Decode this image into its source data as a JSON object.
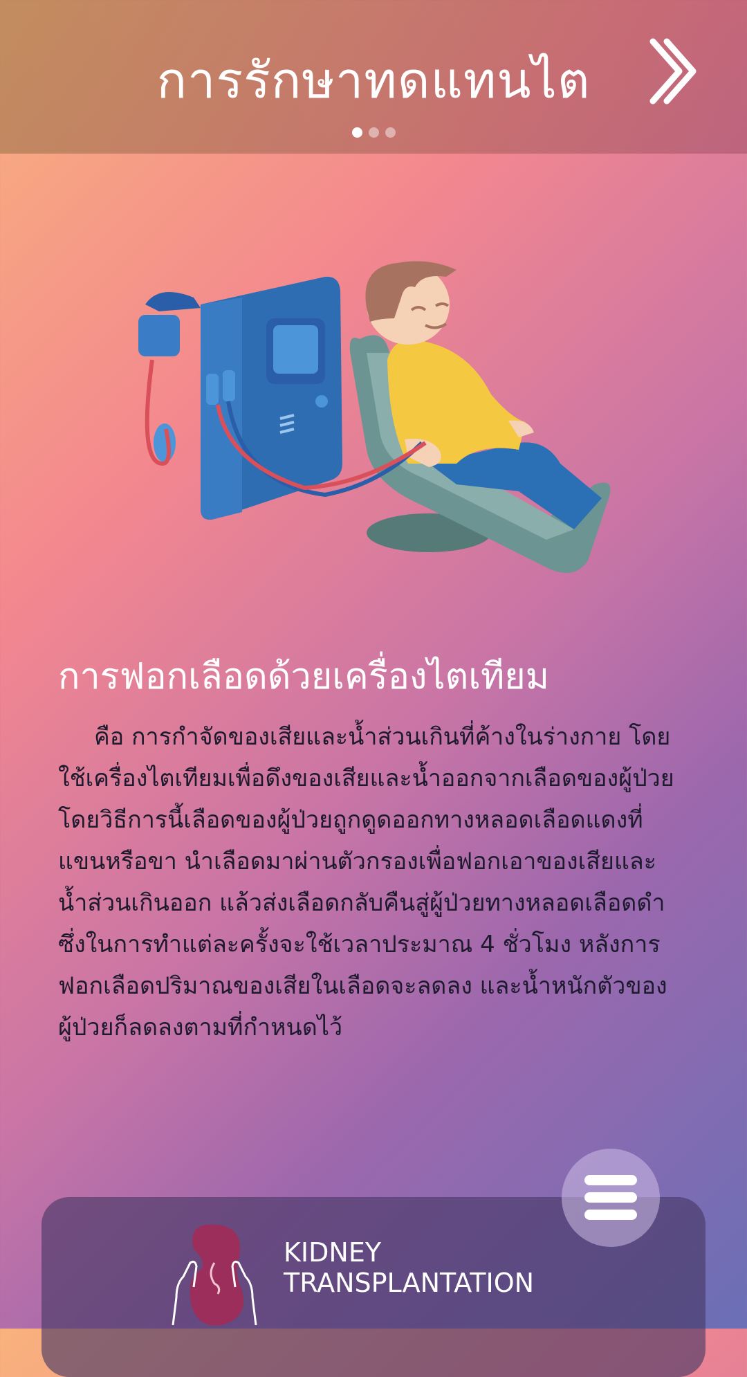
{
  "header": {
    "title": "การรักษาทดแทนไต",
    "page_indicator": {
      "total": 3,
      "active_index": 0
    }
  },
  "icons": {
    "next": "chevron-double-right-icon",
    "menu": "hamburger-menu-icon",
    "logo": "kidney-hands-icon"
  },
  "content": {
    "title": "การฟอกเลือดด้วยเครื่องไตเทียม",
    "paragraph": "คือ การกำจัดของเสียและน้ำส่วนเกินที่ค้างในร่างกาย โดยใช้เครื่องไตเทียมเพื่อดึงของเสียและน้ำออกจากเลือดของผู้ป่วยโดยวิธีการนี้เลือดของผู้ป่วยถูกดูดออกทางหลอดเลือดแดงที่แขนหรือขา นำเลือดมาผ่านตัวกรองเพื่อฟอกเอาของเสียและน้ำส่วนเกินออก แล้วส่งเลือดกลับคืนสู่ผู้ป่วยทางหลอดเลือดดำ ซึ่งในการทำแต่ละครั้งจะใช้เวลาประมาณ 4 ชั่วโมง หลังการฟอกเลือดปริมาณของเสียในเลือดจะลดลง และน้ำหนักตัวของผู้ป่วยก็ลดลงตามที่กำหนดไว้"
  },
  "brand": {
    "line1": "KIDNEY",
    "line2": "TRANSPLANTATION"
  },
  "colors": {
    "machine": "#2f6db3",
    "shirt": "#f5c842",
    "chair": "#6b9492",
    "tube_red": "#d9505a",
    "tube_blue": "#2a5ea8",
    "kidney": "#9b2e5a"
  }
}
